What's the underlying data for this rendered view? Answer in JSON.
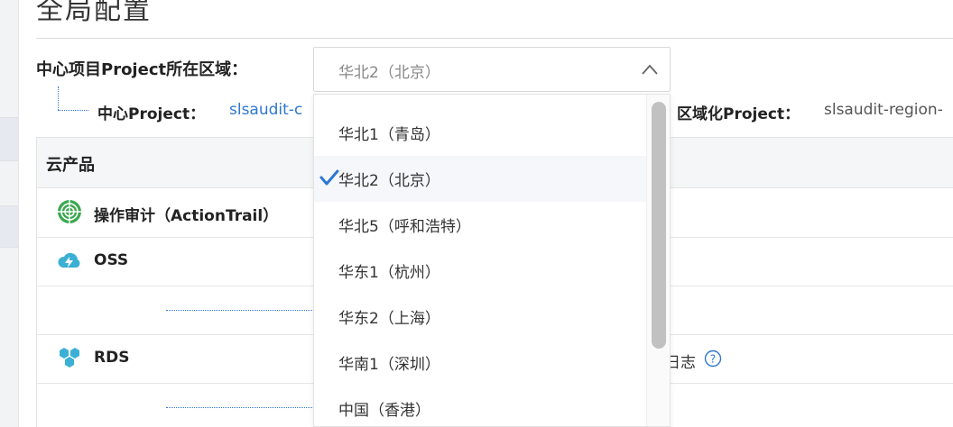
{
  "page": {
    "title": "全局配置",
    "region_label": "中心项目Project所在区域：",
    "selected_region": "华北2（北京）",
    "center_project_label": "中心Project：",
    "center_project_value": "slsaudit-c",
    "regional_project_label": "区域化Project：",
    "regional_project_value": "slsaudit-region-"
  },
  "table": {
    "header_product": "云产品",
    "rows": [
      {
        "name": "操作审计（ActionTrail）",
        "icon": "actiontrail-radar-icon"
      },
      {
        "name": "OSS",
        "icon": "oss-cloud-icon"
      },
      {
        "name": "RDS",
        "icon": "rds-hexagon-icon"
      }
    ],
    "rds_tail_text": "日志"
  },
  "dropdown": {
    "options": [
      {
        "label": "华北1（青岛）",
        "selected": false
      },
      {
        "label": "华北2（北京）",
        "selected": true
      },
      {
        "label": "华北5（呼和浩特）",
        "selected": false
      },
      {
        "label": "华东1（杭州）",
        "selected": false
      },
      {
        "label": "华东2（上海）",
        "selected": false
      },
      {
        "label": "华南1（深圳）",
        "selected": false
      },
      {
        "label": "中国（香港）",
        "selected": false
      }
    ]
  },
  "colors": {
    "accent_blue": "#2f77d1",
    "icon_teal": "#3bb0d4",
    "actiontrail_green": "#3aa84f"
  }
}
